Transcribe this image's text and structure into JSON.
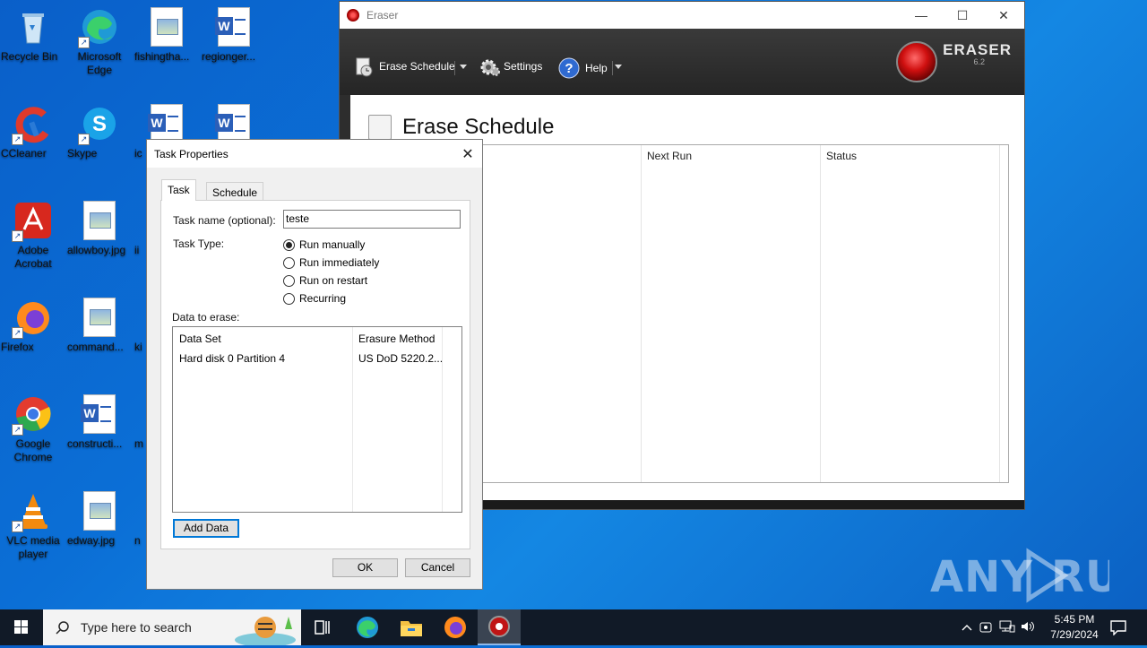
{
  "desktop": {
    "icons": [
      {
        "label": "Recycle Bin"
      },
      {
        "label": "Microsoft Edge"
      },
      {
        "label": "fishingtha..."
      },
      {
        "label": "regionger..."
      },
      {
        "label": "CCleaner"
      },
      {
        "label": "Skype"
      },
      {
        "label": "ic"
      },
      {
        "label": ""
      },
      {
        "label": "Adobe Acrobat"
      },
      {
        "label": "allowboy.jpg"
      },
      {
        "label": "ii"
      },
      {
        "label": "Firefox"
      },
      {
        "label": "command..."
      },
      {
        "label": "ki"
      },
      {
        "label": "Google Chrome"
      },
      {
        "label": "constructi..."
      },
      {
        "label": "m"
      },
      {
        "label": "VLC media player"
      },
      {
        "label": "edway.jpg"
      },
      {
        "label": "n"
      }
    ]
  },
  "eraser": {
    "title": "Eraser",
    "toolbar": {
      "erase_schedule": "Erase Schedule",
      "settings": "Settings",
      "help": "Help"
    },
    "logo": {
      "name": "ERASER",
      "version": "6.2"
    },
    "page_title": "Erase Schedule",
    "columns": {
      "next_run": "Next Run",
      "status": "Status"
    }
  },
  "dialog": {
    "title": "Task Properties",
    "tabs": {
      "task": "Task",
      "schedule": "Schedule"
    },
    "task_name_label": "Task name (optional):",
    "task_name_value": "teste",
    "task_type_label": "Task Type:",
    "task_types": [
      "Run manually",
      "Run immediately",
      "Run on restart",
      "Recurring"
    ],
    "selected_task_type": "Run manually",
    "data_label": "Data to erase:",
    "data_columns": {
      "data_set": "Data Set",
      "method": "Erasure Method"
    },
    "data_rows": [
      {
        "data_set": "Hard disk 0 Partition 4",
        "method": "US DoD 5220.2..."
      }
    ],
    "add_data": "Add Data",
    "ok": "OK",
    "cancel": "Cancel"
  },
  "watermark": "ANY RUN",
  "taskbar": {
    "search_placeholder": "Type here to search",
    "time": "5:45 PM",
    "date": "7/29/2024"
  }
}
